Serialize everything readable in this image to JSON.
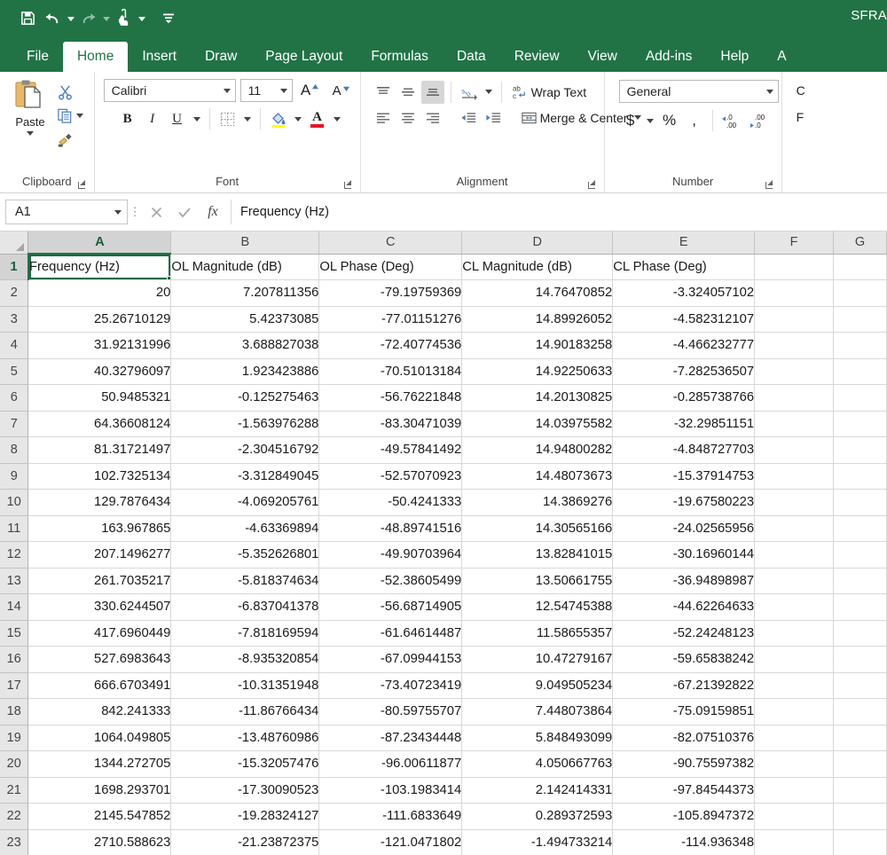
{
  "app": {
    "title": "SFRA",
    "quick_access": [
      {
        "name": "save-icon",
        "label": "Save"
      },
      {
        "name": "undo-icon",
        "label": "Undo"
      },
      {
        "name": "redo-icon",
        "label": "Redo"
      },
      {
        "name": "touch-mouse-mode-icon",
        "label": "Touch/Mouse Mode"
      },
      {
        "name": "customize-quick-access-toolbar-icon",
        "label": "Customize Quick Access Toolbar"
      }
    ]
  },
  "tabs": [
    {
      "label": "File",
      "active": false
    },
    {
      "label": "Home",
      "active": true
    },
    {
      "label": "Insert",
      "active": false
    },
    {
      "label": "Draw",
      "active": false
    },
    {
      "label": "Page Layout",
      "active": false
    },
    {
      "label": "Formulas",
      "active": false
    },
    {
      "label": "Data",
      "active": false
    },
    {
      "label": "Review",
      "active": false
    },
    {
      "label": "View",
      "active": false
    },
    {
      "label": "Add-ins",
      "active": false
    },
    {
      "label": "Help",
      "active": false
    },
    {
      "label": "A",
      "active": false
    }
  ],
  "ribbon": {
    "clipboard": {
      "group_label": "Clipboard",
      "paste_label": "Paste",
      "cut_label": "Cut",
      "copy_label": "Copy",
      "format_painter_label": "Format Painter"
    },
    "font": {
      "group_label": "Font",
      "font_name": "Calibri",
      "font_size": "11",
      "grow_font_label": "A",
      "shrink_font_label": "A",
      "bold_label": "B",
      "italic_label": "I",
      "underline_label": "U",
      "borders_label": "Borders",
      "fill_color_label": "Fill Color",
      "font_color_label": "A"
    },
    "alignment": {
      "group_label": "Alignment",
      "wrap_text_label": "Wrap Text",
      "wrap_text_icon_label": "ab",
      "merge_center_label": "Merge & Center",
      "orientation_label": "Orientation",
      "decrease_indent_label": "Decrease Indent",
      "increase_indent_label": "Increase Indent"
    },
    "number": {
      "group_label": "Number",
      "format": "General",
      "currency_label": "$",
      "percent_label": "%",
      "comma_label": ",",
      "increase_decimal_label": ".00",
      "decrease_decimal_label": ".00"
    },
    "styles": {
      "line1": "C",
      "line2": "F"
    }
  },
  "formula_bar": {
    "name_box": "A1",
    "cancel_label": "✕",
    "enter_label": "✓",
    "fx_label": "fx",
    "content": "Frequency (Hz)",
    "placeholder": ""
  },
  "sheet": {
    "selected_cell": "A1",
    "columns": [
      "A",
      "B",
      "C",
      "D",
      "E",
      "F",
      "G"
    ],
    "headers": [
      "Frequency (Hz)",
      "OL Magnitude (dB)",
      "OL Phase (Deg)",
      "CL Magnitude (dB)",
      "CL Phase (Deg)",
      "",
      ""
    ],
    "rows": [
      {
        "n": "1",
        "cells": [
          "Frequency (Hz)",
          "OL Magnitude (dB)",
          "OL Phase (Deg)",
          "CL Magnitude (dB)",
          "CL Phase (Deg)",
          "",
          ""
        ]
      },
      {
        "n": "2",
        "cells": [
          "20",
          "7.207811356",
          "-79.19759369",
          "14.76470852",
          "-3.324057102",
          "",
          ""
        ]
      },
      {
        "n": "3",
        "cells": [
          "25.26710129",
          "5.42373085",
          "-77.01151276",
          "14.89926052",
          "-4.582312107",
          "",
          ""
        ]
      },
      {
        "n": "4",
        "cells": [
          "31.92131996",
          "3.688827038",
          "-72.40774536",
          "14.90183258",
          "-4.466232777",
          "",
          ""
        ]
      },
      {
        "n": "5",
        "cells": [
          "40.32796097",
          "1.923423886",
          "-70.51013184",
          "14.92250633",
          "-7.282536507",
          "",
          ""
        ]
      },
      {
        "n": "6",
        "cells": [
          "50.9485321",
          "-0.125275463",
          "-56.76221848",
          "14.20130825",
          "-0.285738766",
          "",
          ""
        ]
      },
      {
        "n": "7",
        "cells": [
          "64.36608124",
          "-1.563976288",
          "-83.30471039",
          "14.03975582",
          "-32.29851151",
          "",
          ""
        ]
      },
      {
        "n": "8",
        "cells": [
          "81.31721497",
          "-2.304516792",
          "-49.57841492",
          "14.94800282",
          "-4.848727703",
          "",
          ""
        ]
      },
      {
        "n": "9",
        "cells": [
          "102.7325134",
          "-3.312849045",
          "-52.57070923",
          "14.48073673",
          "-15.37914753",
          "",
          ""
        ]
      },
      {
        "n": "10",
        "cells": [
          "129.7876434",
          "-4.069205761",
          "-50.4241333",
          "14.3869276",
          "-19.67580223",
          "",
          ""
        ]
      },
      {
        "n": "11",
        "cells": [
          "163.967865",
          "-4.63369894",
          "-48.89741516",
          "14.30565166",
          "-24.02565956",
          "",
          ""
        ]
      },
      {
        "n": "12",
        "cells": [
          "207.1496277",
          "-5.352626801",
          "-49.90703964",
          "13.82841015",
          "-30.16960144",
          "",
          ""
        ]
      },
      {
        "n": "13",
        "cells": [
          "261.7035217",
          "-5.818374634",
          "-52.38605499",
          "13.50661755",
          "-36.94898987",
          "",
          ""
        ]
      },
      {
        "n": "14",
        "cells": [
          "330.6244507",
          "-6.837041378",
          "-56.68714905",
          "12.54745388",
          "-44.62264633",
          "",
          ""
        ]
      },
      {
        "n": "15",
        "cells": [
          "417.6960449",
          "-7.818169594",
          "-61.64614487",
          "11.58655357",
          "-52.24248123",
          "",
          ""
        ]
      },
      {
        "n": "16",
        "cells": [
          "527.6983643",
          "-8.935320854",
          "-67.09944153",
          "10.47279167",
          "-59.65838242",
          "",
          ""
        ]
      },
      {
        "n": "17",
        "cells": [
          "666.6703491",
          "-10.31351948",
          "-73.40723419",
          "9.049505234",
          "-67.21392822",
          "",
          ""
        ]
      },
      {
        "n": "18",
        "cells": [
          "842.241333",
          "-11.86766434",
          "-80.59755707",
          "7.448073864",
          "-75.09159851",
          "",
          ""
        ]
      },
      {
        "n": "19",
        "cells": [
          "1064.049805",
          "-13.48760986",
          "-87.23434448",
          "5.848493099",
          "-82.07510376",
          "",
          ""
        ]
      },
      {
        "n": "20",
        "cells": [
          "1344.272705",
          "-15.32057476",
          "-96.00611877",
          "4.050667763",
          "-90.75597382",
          "",
          ""
        ]
      },
      {
        "n": "21",
        "cells": [
          "1698.293701",
          "-17.30090523",
          "-103.1983414",
          "2.142414331",
          "-97.84544373",
          "",
          ""
        ]
      },
      {
        "n": "22",
        "cells": [
          "2145.547852",
          "-19.28324127",
          "-111.6833649",
          "0.289372593",
          "-105.8947372",
          "",
          ""
        ]
      },
      {
        "n": "23",
        "cells": [
          "2710.588623",
          "-21.23872375",
          "-121.0471802",
          "-1.494733214",
          "-114.936348",
          "",
          ""
        ]
      }
    ]
  },
  "colors": {
    "brand_green": "#217346",
    "selection_green": "#1a6b43",
    "header_gray": "#e6e6e6",
    "grid_line": "#d8d8d8"
  }
}
